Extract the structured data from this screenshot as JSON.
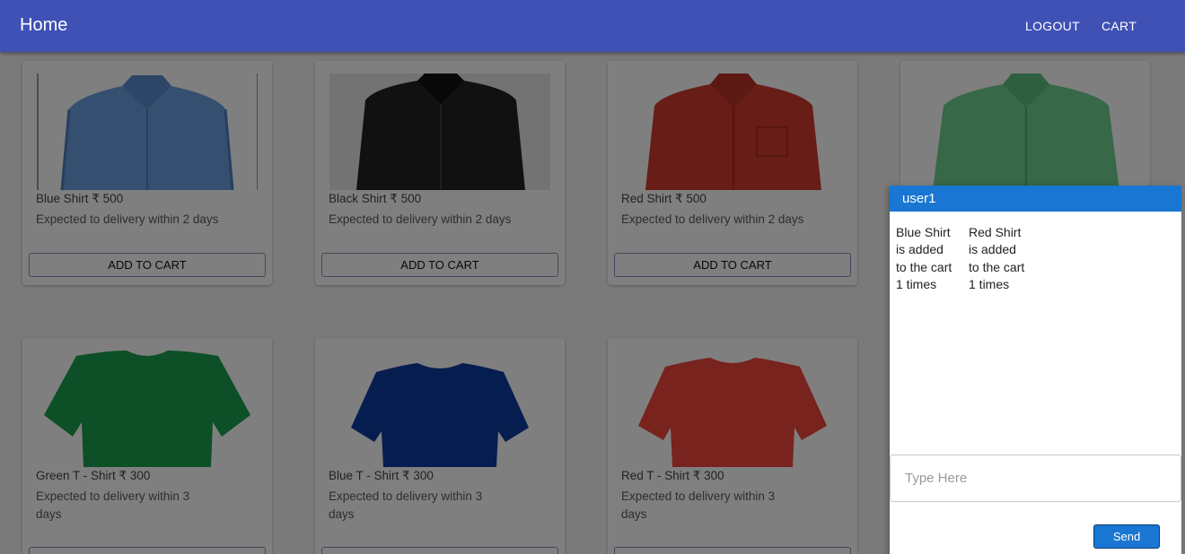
{
  "appbar": {
    "brand": "Home",
    "logout_label": "LOGOUT",
    "cart_label": "CART"
  },
  "products": [
    {
      "title": "Blue Shirt ₹ 500",
      "delivery": "Expected to delivery within 2 days",
      "button": "ADD TO CART",
      "image": "blue-shirt-image"
    },
    {
      "title": "Black Shirt ₹ 500",
      "delivery": "Expected to delivery within 2 days",
      "button": "ADD TO CART",
      "image": "black-shirt-image"
    },
    {
      "title": "Red Shirt ₹ 500",
      "delivery": "Expected to delivery within 2 days",
      "button": "ADD TO CART",
      "image": "red-shirt-image"
    },
    {
      "title": "",
      "delivery": "",
      "button": "",
      "image": "green-shirt-image"
    },
    {
      "title": "Green T - Shirt ₹ 300",
      "delivery": "Expected to delivery within 3 days",
      "button": "",
      "image": "green-tshirt-image"
    },
    {
      "title": "Blue T - Shirt ₹ 300",
      "delivery": "Expected to delivery within 3 days",
      "button": "",
      "image": "blue-tshirt-image"
    },
    {
      "title": "Red T - Shirt ₹ 300",
      "delivery": "Expected to delivery within 3 days",
      "button": "",
      "image": "red-tshirt-image"
    }
  ],
  "chat": {
    "user": "user1",
    "messages": [
      "Blue Shirt is added to the cart 1 times",
      "Red Shirt is added to the cart 1 times"
    ],
    "placeholder": "Type Here",
    "send_label": "Send"
  },
  "colors": {
    "appbar": "#3f51b5",
    "chat_header": "#1976d2",
    "send_button": "#1976d2"
  }
}
